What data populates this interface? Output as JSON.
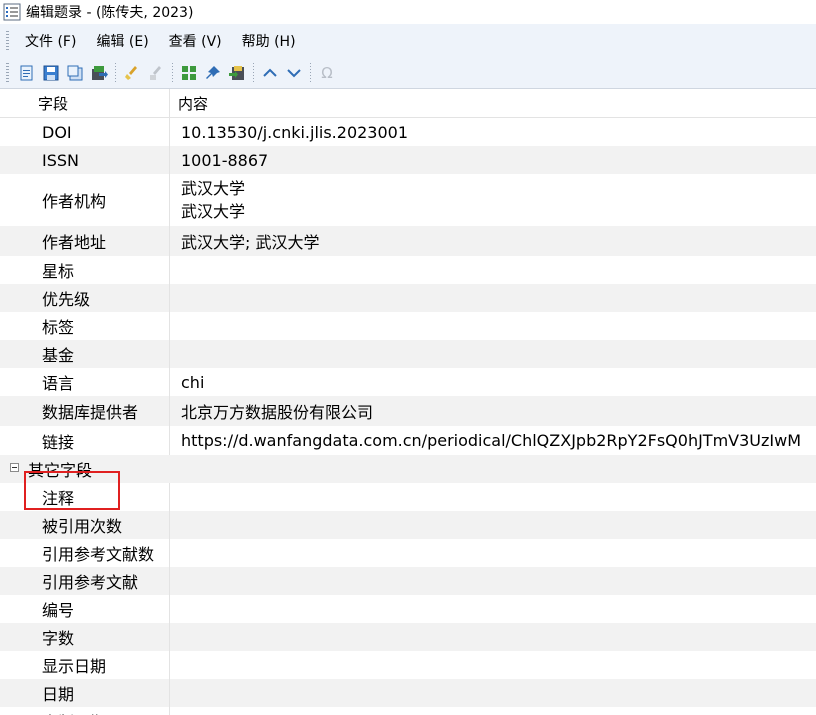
{
  "window": {
    "title": "编辑题录 - (陈传夫, 2023)"
  },
  "menu": [
    {
      "label": "文件 (F)"
    },
    {
      "label": "编辑 (E)"
    },
    {
      "label": "查看 (V)"
    },
    {
      "label": "帮助 (H)"
    }
  ],
  "toolbar_icons": [
    "new-record-icon",
    "save-icon",
    "save-copy-icon",
    "export-icon",
    "clear-icon",
    "broom-disabled-icon",
    "grid-icon",
    "pin-icon",
    "import-icon",
    "move-up-icon",
    "move-down-icon",
    "omega-icon"
  ],
  "toolbar": {
    "omega_label": "Ω"
  },
  "columns": {
    "field": "字段",
    "value": "内容"
  },
  "rows": [
    {
      "field": "DOI",
      "value": [
        "10.13530/j.cnki.jlis.2023001"
      ]
    },
    {
      "field": "ISSN",
      "value": [
        "1001-8867"
      ]
    },
    {
      "field": "作者机构",
      "value": [
        "武汉大学",
        "武汉大学"
      ]
    },
    {
      "field": "作者地址",
      "value": [
        "武汉大学; 武汉大学"
      ]
    },
    {
      "field": "星标",
      "value": []
    },
    {
      "field": "优先级",
      "value": []
    },
    {
      "field": "标签",
      "value": []
    },
    {
      "field": "基金",
      "value": []
    },
    {
      "field": "语言",
      "value": [
        "chi"
      ]
    },
    {
      "field": "数据库提供者",
      "value": [
        "北京万方数据股份有限公司"
      ]
    },
    {
      "field": "链接",
      "value": [
        "https://d.wanfangdata.com.cn/periodical/ChlQZXJpb2RpY2FsQ0hJTmV3UzIwM"
      ]
    }
  ],
  "group": {
    "label": "其它字段"
  },
  "other_rows": [
    {
      "field": "注释"
    },
    {
      "field": "被引用次数"
    },
    {
      "field": "引用参考文献数"
    },
    {
      "field": "引用参考文献"
    },
    {
      "field": "编号"
    },
    {
      "field": "字数"
    },
    {
      "field": "显示日期"
    },
    {
      "field": "日期"
    },
    {
      "field": "出版日期"
    }
  ],
  "colors": {
    "highlight": "#e02020",
    "chrome": "#eef3fa",
    "alt_row": "#f2f2f2"
  }
}
